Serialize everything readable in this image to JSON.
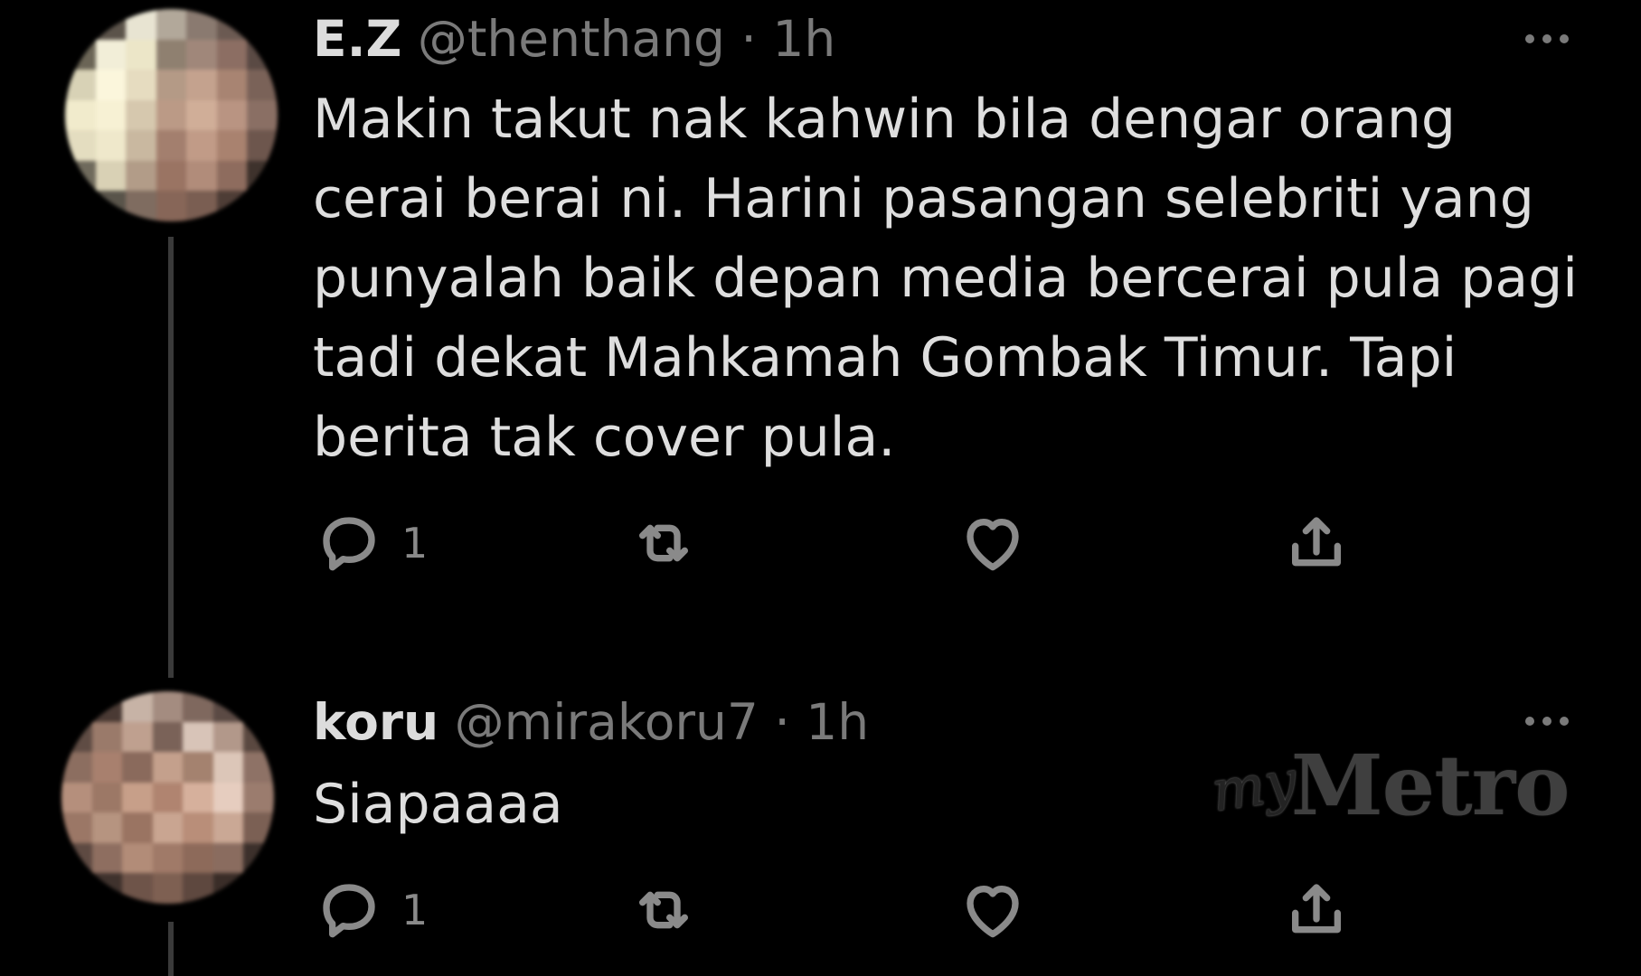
{
  "tweets": [
    {
      "name": "E.Z",
      "handle": "@thenthang",
      "separator": "·",
      "time": "1h",
      "text": "Makin takut nak kahwin bila dengar orang cerai berai ni. Harini pasangan selebriti yang punyalah baik depan media bercerai pula pagi tadi dekat Mahkamah Gombak Timur. Tapi berita tak cover pula.",
      "reply_count": "1",
      "avatar_icon": "avatar-pixelated"
    },
    {
      "name": "koru",
      "handle": "@mirakoru7",
      "separator": "·",
      "time": "1h",
      "text": "Siapaaaa",
      "reply_count": "1",
      "avatar_icon": "avatar-pixelated"
    }
  ],
  "action_icons": [
    "reply-icon",
    "retweet-icon",
    "like-icon",
    "share-icon"
  ],
  "watermark": {
    "my": "my",
    "brand": "Metro"
  },
  "colors": {
    "background": "#000000",
    "text": "#dedede",
    "muted": "#7a7a7a",
    "icon": "#8a8a8a"
  }
}
